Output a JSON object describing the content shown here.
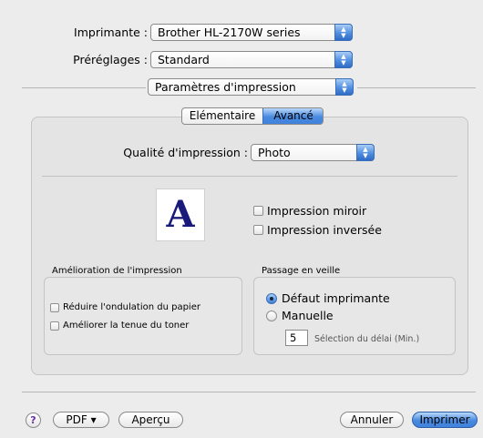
{
  "printer": {
    "label": "Imprimante :",
    "value": "Brother HL-2170W series"
  },
  "presets": {
    "label": "Préréglages :",
    "value": "Standard"
  },
  "panel_menu": {
    "value": "Paramètres d'impression"
  },
  "tabs": [
    {
      "label": "Elémentaire",
      "selected": false
    },
    {
      "label": "Avancé",
      "selected": true
    }
  ],
  "quality": {
    "label": "Qualité d'impression :",
    "value": "Photo"
  },
  "preview_glyph": "A",
  "options": {
    "mirror": {
      "label": "Impression miroir",
      "checked": false
    },
    "reverse": {
      "label": "Impression inversée",
      "checked": false
    }
  },
  "improvement": {
    "title": "Amélioration de l'impression",
    "items": [
      {
        "label": "Réduire l'ondulation du papier",
        "checked": false
      },
      {
        "label": "Améliorer la tenue du toner",
        "checked": false
      }
    ]
  },
  "sleep": {
    "title": "Passage en veille",
    "options": [
      {
        "label": "Défaut imprimante",
        "selected": true
      },
      {
        "label": "Manuelle",
        "selected": false
      }
    ],
    "delay_value": "5",
    "delay_label": "Sélection du délai (Min.)"
  },
  "footer": {
    "help": "?",
    "pdf": "PDF ▾",
    "preview": "Aperçu",
    "cancel": "Annuler",
    "print": "Imprimer"
  },
  "colors": {
    "accent": "#3f82dc",
    "glyph": "#1a1a7a"
  }
}
